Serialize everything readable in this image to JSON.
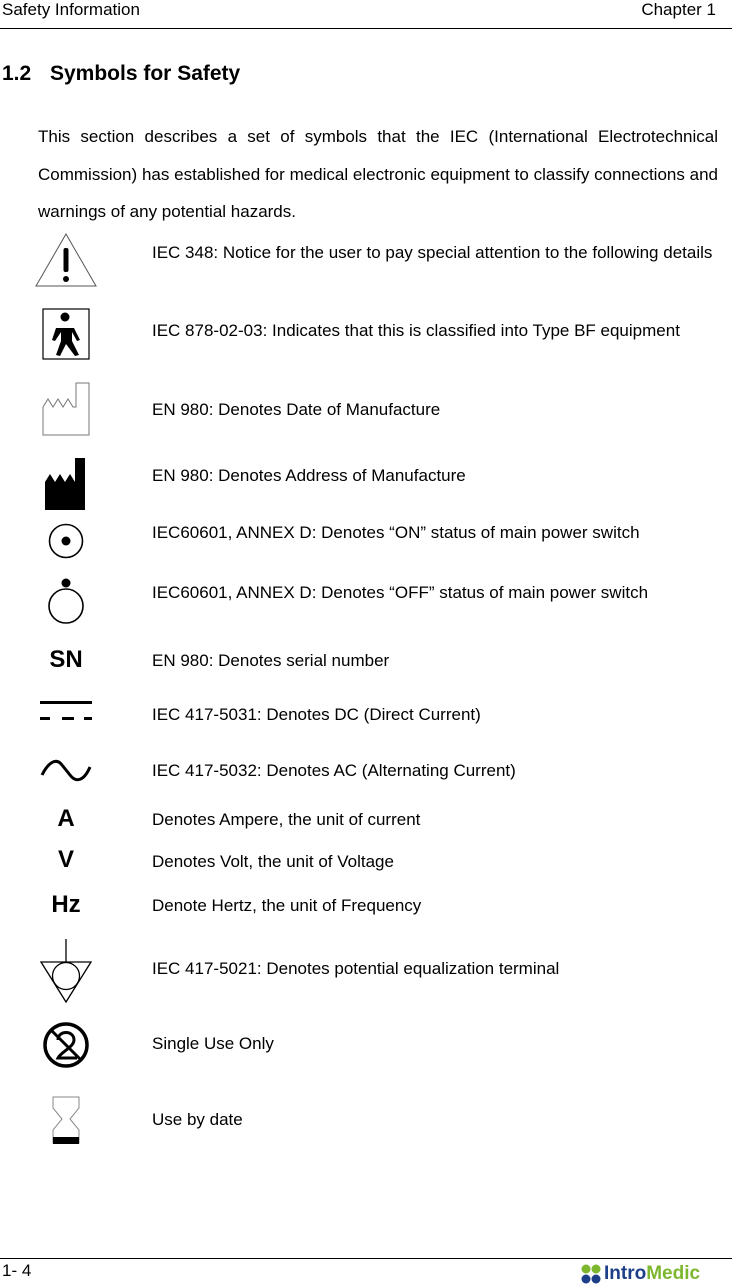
{
  "header": {
    "left": "Safety Information",
    "right": "Chapter 1"
  },
  "section": {
    "number": "1.2",
    "title": "Symbols for Safety"
  },
  "intro": "This section describes a set of symbols that the IEC (International Electrotechnical Commission) has established for medical electronic equipment to classify connections and warnings of any potential hazards.",
  "symbols": [
    {
      "icon": "warning-triangle-icon",
      "description": "IEC 348: Notice for the user to pay special attention to the following details"
    },
    {
      "icon": "type-bf-icon",
      "description": "IEC 878-02-03: Indicates that this is classified into Type BF equipment"
    },
    {
      "icon": "date-of-manufacture-icon",
      "description": "EN 980: Denotes Date of Manufacture"
    },
    {
      "icon": "manufacturer-icon",
      "description": "EN 980: Denotes Address of Manufacture"
    },
    {
      "icon": "power-on-icon",
      "description": "IEC60601, ANNEX D: Denotes “ON” status of main power switch"
    },
    {
      "icon": "power-off-icon",
      "description": "IEC60601, ANNEX D: Denotes “OFF” status of main power switch"
    },
    {
      "icon": "serial-number-icon",
      "label": "SN",
      "description": "EN 980: Denotes serial number"
    },
    {
      "icon": "dc-icon",
      "description": "IEC 417-5031: Denotes DC (Direct Current)"
    },
    {
      "icon": "ac-icon",
      "description": "IEC 417-5032: Denotes AC (Alternating Current)"
    },
    {
      "icon": "ampere-icon",
      "label": "A",
      "description": "Denotes Ampere, the unit of current"
    },
    {
      "icon": "volt-icon",
      "label": "V",
      "description": "Denotes Volt, the unit of Voltage"
    },
    {
      "icon": "hertz-icon",
      "label": "Hz",
      "description": "Denote Hertz, the unit of Frequency"
    },
    {
      "icon": "equipotential-icon",
      "description": "IEC 417-5021: Denotes potential equalization terminal"
    },
    {
      "icon": "single-use-icon",
      "description": "Single Use Only"
    },
    {
      "icon": "use-by-date-icon",
      "description": "Use by date"
    }
  ],
  "footer": {
    "page": "1- 4",
    "logo_part1": "Intro",
    "logo_part2": "Medic"
  },
  "colors": {
    "logo_blue": "#1d3e88",
    "logo_green": "#7db72f"
  }
}
